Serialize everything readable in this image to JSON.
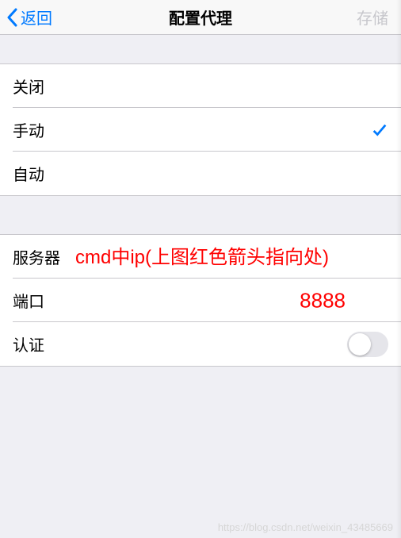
{
  "nav": {
    "back_label": "返回",
    "title": "配置代理",
    "save_label": "存储"
  },
  "proxy_modes": {
    "off": "关闭",
    "manual": "手动",
    "auto": "自动"
  },
  "fields": {
    "server_label": "服务器",
    "port_label": "端口",
    "auth_label": "认证"
  },
  "annotations": {
    "server_hint": "cmd中ip(上图红色箭头指向处)",
    "port_value": "8888"
  },
  "watermark": "https://blog.csdn.net/weixin_43485669"
}
